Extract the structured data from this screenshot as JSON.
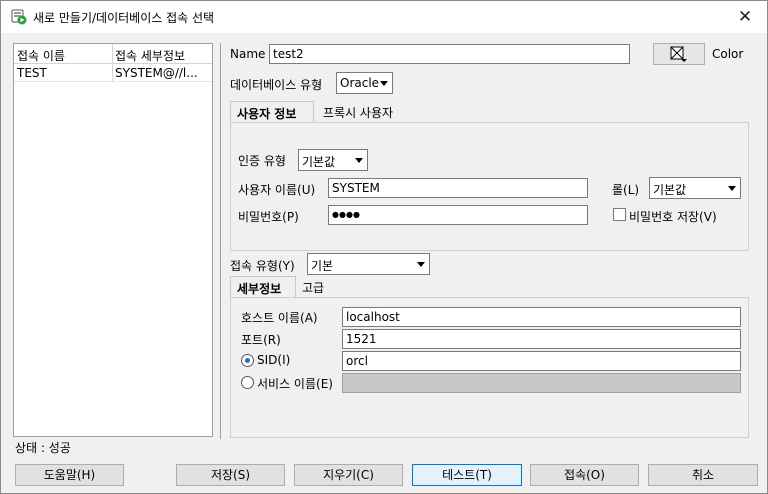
{
  "window": {
    "title": "새로 만들기/데이터베이스 접속 선택",
    "close_glyph": "✕"
  },
  "connection_list": {
    "headers": [
      "접속 이름",
      "접속 세부정보"
    ],
    "rows": [
      {
        "name": "TEST",
        "details": "SYSTEM@//l..."
      }
    ]
  },
  "form": {
    "name_label": "Name",
    "name_value": "test2",
    "color_label": "Color",
    "db_type_label": "데이터베이스 유형",
    "db_type_value": "Oracle"
  },
  "user_tabs": {
    "active": "사용자 정보",
    "inactive": "프록시 사용자"
  },
  "user_info": {
    "auth_type_label": "인증 유형",
    "auth_type_value": "기본값",
    "username_label": "사용자 이름(U)",
    "username_value": "SYSTEM",
    "password_label": "비밀번호(P)",
    "password_value": "●●●●",
    "role_label": "롤(L)",
    "role_value": "기본값",
    "save_password_label": "비밀번호 저장(V)"
  },
  "connection_type": {
    "label": "접속 유형(Y)",
    "value": "기본"
  },
  "detail_tabs": {
    "active": "세부정보",
    "inactive": "고급"
  },
  "details": {
    "host_label": "호스트 이름(A)",
    "host_value": "localhost",
    "port_label": "포트(R)",
    "port_value": "1521",
    "sid_label": "SID(I)",
    "sid_value": "orcl",
    "service_label": "서비스 이름(E)",
    "service_value": "",
    "selected": "sid"
  },
  "status": "상태 : 성공",
  "buttons": {
    "help": "도움말(H)",
    "save": "저장(S)",
    "clear": "지우기(C)",
    "test": "테스트(T)",
    "connect": "접속(O)",
    "cancel": "취소"
  },
  "colors": {
    "accent": "#0078d7",
    "radio_dot": "#1a6fd1",
    "app_icon": "#2e9e3e"
  }
}
